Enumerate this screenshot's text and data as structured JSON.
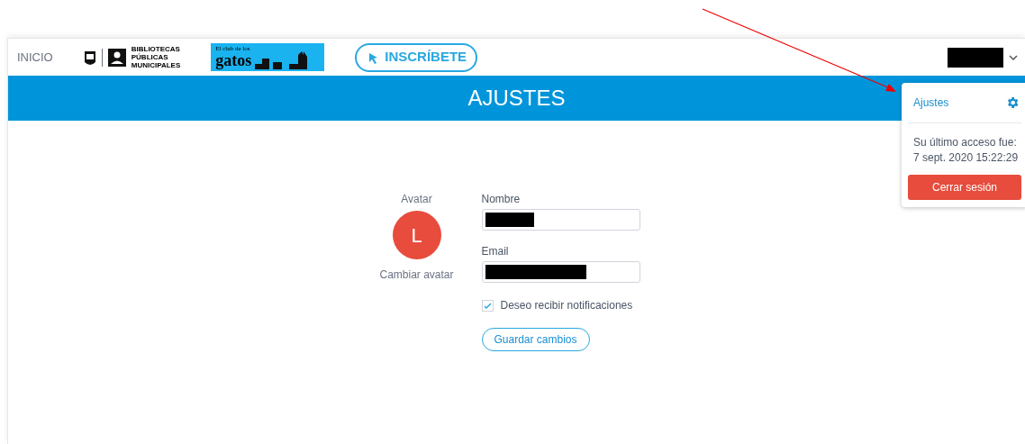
{
  "header": {
    "home_link": "INICIO",
    "library_logo": {
      "lines": [
        "BIBLIOTECAS",
        "PÚBLICAS",
        "MUNICIPALES"
      ]
    },
    "club_banner": {
      "small": "El club de los",
      "big": "gatos"
    },
    "signup_button": "INSCRÍBETE",
    "user_menu": {
      "expanded": true
    }
  },
  "banner": {
    "title": "AJUSTES"
  },
  "avatar": {
    "label": "Avatar",
    "initial": "L",
    "change_link": "Cambiar avatar"
  },
  "form": {
    "fields": [
      {
        "label": "Nombre"
      },
      {
        "label": "Email"
      }
    ],
    "notifications": {
      "label": "Deseo recibir notificaciones",
      "checked": true
    },
    "save_button": "Guardar cambios"
  },
  "dropdown": {
    "settings_link": "Ajustes",
    "last_access_label": "Su último acceso fue:",
    "last_access_time": "7 sept. 2020 15:22:29",
    "logout_button": "Cerrar sesión"
  }
}
